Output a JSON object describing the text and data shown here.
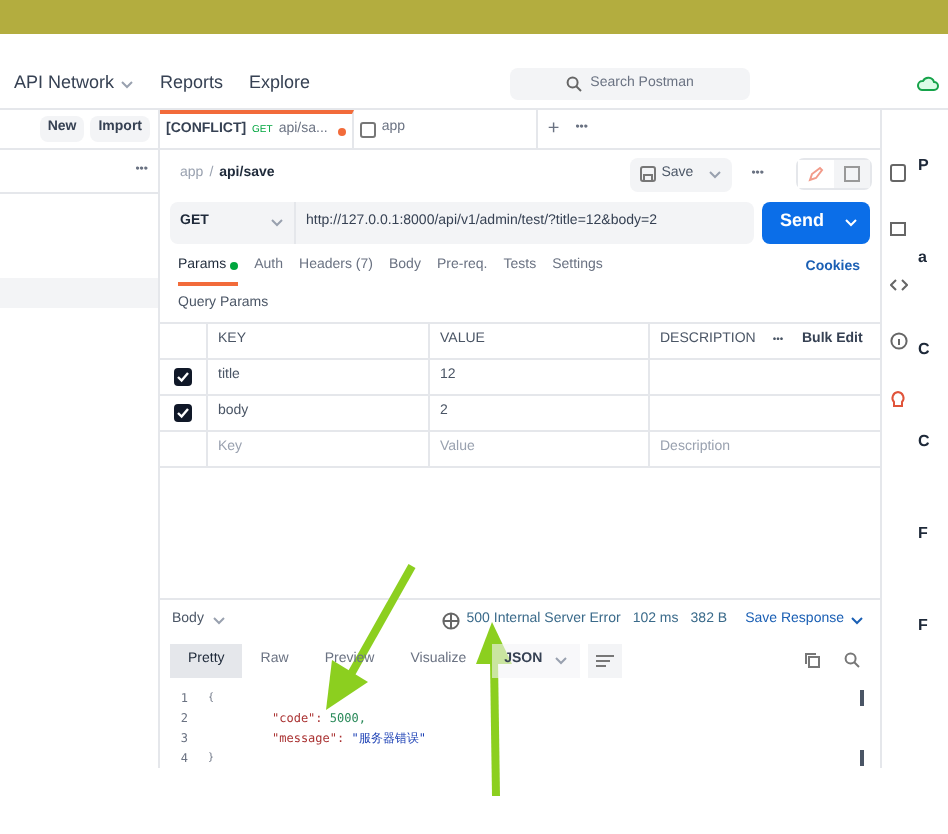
{
  "header": {
    "items": [
      {
        "label": "API Network",
        "dropdown": true
      },
      {
        "label": "Reports",
        "dropdown": false
      },
      {
        "label": "Explore",
        "dropdown": false
      }
    ],
    "search": {
      "placeholder": "Search Postman"
    }
  },
  "sidebar": {
    "buttons": [
      "New",
      "Import"
    ],
    "more": "•••"
  },
  "tabs": [
    {
      "prefix": "[CONFLICT]",
      "method": "GET",
      "label": "api/sa...",
      "unsaved": true,
      "selected": true
    },
    {
      "label": "app",
      "unsaved": false,
      "selected": false
    }
  ],
  "tab_actions": [
    "+",
    "•••"
  ],
  "breadcrumb": {
    "parent": "app",
    "separator": "/",
    "current": "api/save"
  },
  "save_button": "Save",
  "more": "•••",
  "mode_toggle": [
    {
      "kind": "edit",
      "selected": true
    },
    {
      "kind": "document",
      "selected": false
    }
  ],
  "request": {
    "method": "GET",
    "url": "http://127.0.0.1:8000/api/v1/admin/test/?title=12&body=2",
    "send": "Send"
  },
  "request_tabs": [
    {
      "label": "Params",
      "dot": true,
      "selected": true
    },
    {
      "label": "Auth",
      "dot": false,
      "selected": false
    },
    {
      "label": "Headers (7)",
      "dot": false,
      "selected": false
    },
    {
      "label": "Body",
      "dot": false,
      "selected": false
    },
    {
      "label": "Pre-req.",
      "dot": false,
      "selected": false
    },
    {
      "label": "Tests",
      "dot": false,
      "selected": false
    },
    {
      "label": "Settings",
      "dot": false,
      "selected": false
    }
  ],
  "cookies": "Cookies",
  "query_params": {
    "title": "Query Params",
    "columns": [
      "KEY",
      "VALUE",
      "DESCRIPTION"
    ],
    "more": "•••",
    "bulk_edit": "Bulk Edit",
    "rows": [
      {
        "key": "title",
        "value": "12",
        "checked": true
      },
      {
        "key": "body",
        "value": "2",
        "checked": true
      }
    ],
    "new_row": {
      "key": {
        "placeholder": "Key"
      },
      "value": {
        "placeholder": "Value"
      },
      "description": {
        "placeholder": "Description"
      }
    }
  },
  "response": {
    "label": "Body",
    "status": "500 Internal Server Error",
    "time": "102 ms",
    "size": "382 B",
    "save": "Save Response",
    "views": [
      {
        "label": "Pretty",
        "selected": true
      },
      {
        "label": "Raw",
        "selected": false
      },
      {
        "label": "Preview",
        "selected": false
      },
      {
        "label": "Visualize",
        "selected": false
      }
    ],
    "format": "JSON",
    "lines": [
      {
        "number": "1",
        "text": "{"
      },
      {
        "number": "2",
        "key": "\"code\":",
        "value": "5000,",
        "kind": "number"
      },
      {
        "number": "3",
        "key": "\"message\":",
        "value": "\"服务器错误\"",
        "kind": "string"
      },
      {
        "number": "4",
        "text": "}"
      }
    ]
  },
  "right_panel": [
    "P",
    "a",
    "C",
    "C",
    "F",
    "F"
  ]
}
